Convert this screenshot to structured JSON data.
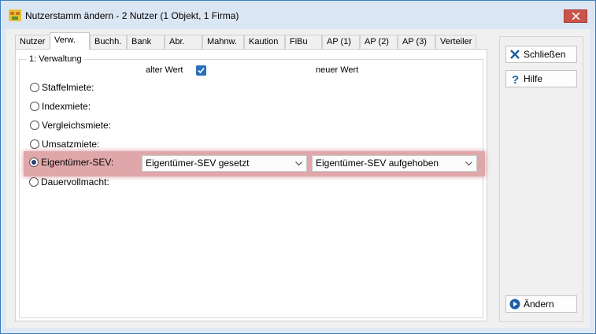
{
  "window": {
    "title": "Nutzerstamm ändern - 2 Nutzer (1 Objekt, 1 Firma)"
  },
  "tabs": [
    {
      "label": "Nutzer",
      "active": false
    },
    {
      "label": "Verw.",
      "active": true
    },
    {
      "label": "Buchh.",
      "active": false
    },
    {
      "label": "Bank",
      "active": false
    },
    {
      "label": "Abr.",
      "active": false
    },
    {
      "label": "Mahnw.",
      "active": false
    },
    {
      "label": "Kaution",
      "active": false
    },
    {
      "label": "FiBu",
      "active": false
    },
    {
      "label": "AP (1)",
      "active": false
    },
    {
      "label": "AP (2)",
      "active": false
    },
    {
      "label": "AP (3)",
      "active": false
    },
    {
      "label": "Verteiler",
      "active": false
    }
  ],
  "group": {
    "legend": "1: Verwaltung",
    "old_value_header": "alter Wert",
    "new_value_header": "neuer Wert",
    "old_value_checked": true,
    "rows": [
      {
        "label": "Staffelmiete:",
        "selected": false
      },
      {
        "label": "Indexmiete:",
        "selected": false
      },
      {
        "label": "Vergleichsmiete:",
        "selected": false
      },
      {
        "label": "Umsatzmiete:",
        "selected": false
      },
      {
        "label": "Eigentümer-SEV:",
        "selected": true,
        "old_value": "Eigentümer-SEV gesetzt",
        "new_value": "Eigentümer-SEV aufgehoben"
      },
      {
        "label": "Dauervollmacht:",
        "selected": false
      }
    ]
  },
  "buttons": {
    "close": "Schließen",
    "help": "Hilfe",
    "apply": "Ändern"
  },
  "colors": {
    "highlight": "#e0a7aa",
    "accent": "#2b6fb6",
    "close_button": "#c9544b"
  }
}
